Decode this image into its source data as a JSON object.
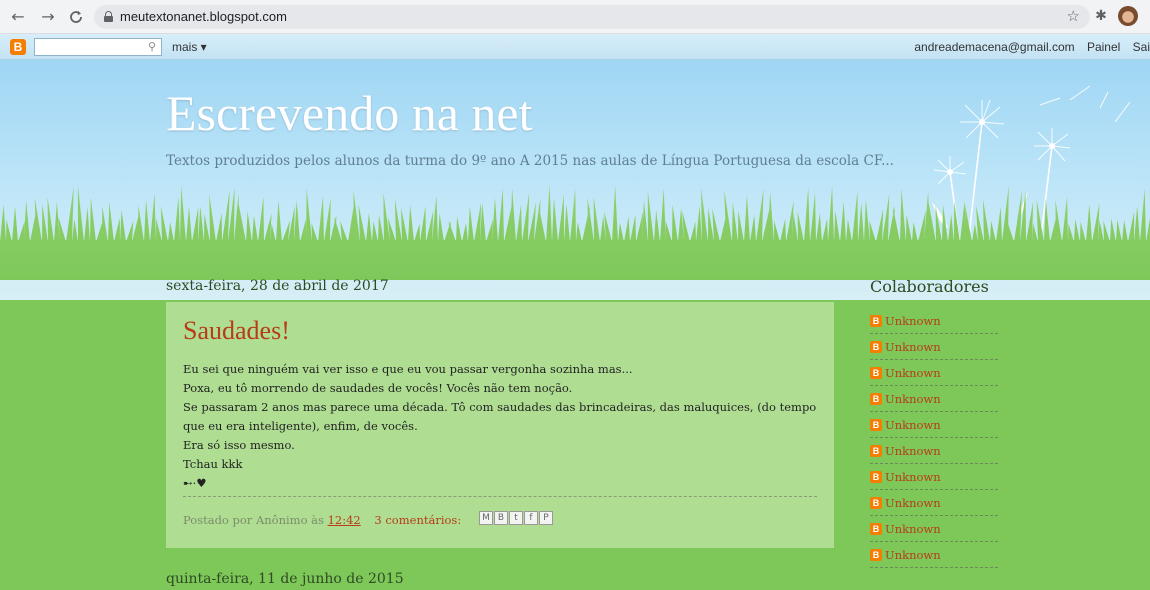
{
  "browser": {
    "url": "meutextonanet.blogspot.com",
    "back_icon": "←",
    "forward_icon": "→",
    "reload_icon": "C"
  },
  "navbar": {
    "logo": "B",
    "search_placeholder": "",
    "more_label": "mais ▾",
    "email": "andreademacena@gmail.com",
    "panel_label": "Painel",
    "exit_label": "Sai"
  },
  "header": {
    "title": "Escrevendo na net",
    "description": "Textos produzidos pelos alunos da turma do 9º ano A 2015 nas aulas de Língua Portuguesa da escola CF..."
  },
  "posts": [
    {
      "date": "sexta-feira, 28 de abril de 2017",
      "title": "Saudades!",
      "lines": [
        "Eu sei que ninguém vai ver isso e que eu vou passar vergonha sozinha mas...",
        "Poxa, eu tô morrendo de saudades de vocês! Vocês não tem noção.",
        "Se passaram 2 anos mas parece uma década. Tô com saudades das brincadeiras, das maluquices, (do tempo que eu era inteligente), enfim, de vocês.",
        "Era só isso mesmo.",
        "Tchau kkk",
        "➸·♥"
      ],
      "footer_prefix": "Postado por Anônimo às",
      "time": "12:42",
      "comments": "3 comentários:"
    }
  ],
  "next_post_date": "quinta-feira, 11 de junho de 2015",
  "sidebar": {
    "title": "Colaboradores",
    "contributors": [
      "Unknown",
      "Unknown",
      "Unknown",
      "Unknown",
      "Unknown",
      "Unknown",
      "Unknown",
      "Unknown",
      "Unknown",
      "Unknown"
    ]
  },
  "colors": {
    "link": "#b73c17",
    "blogger_orange": "#f57d00",
    "grass": "#7ec85a",
    "sky": "#9fd6f4"
  }
}
